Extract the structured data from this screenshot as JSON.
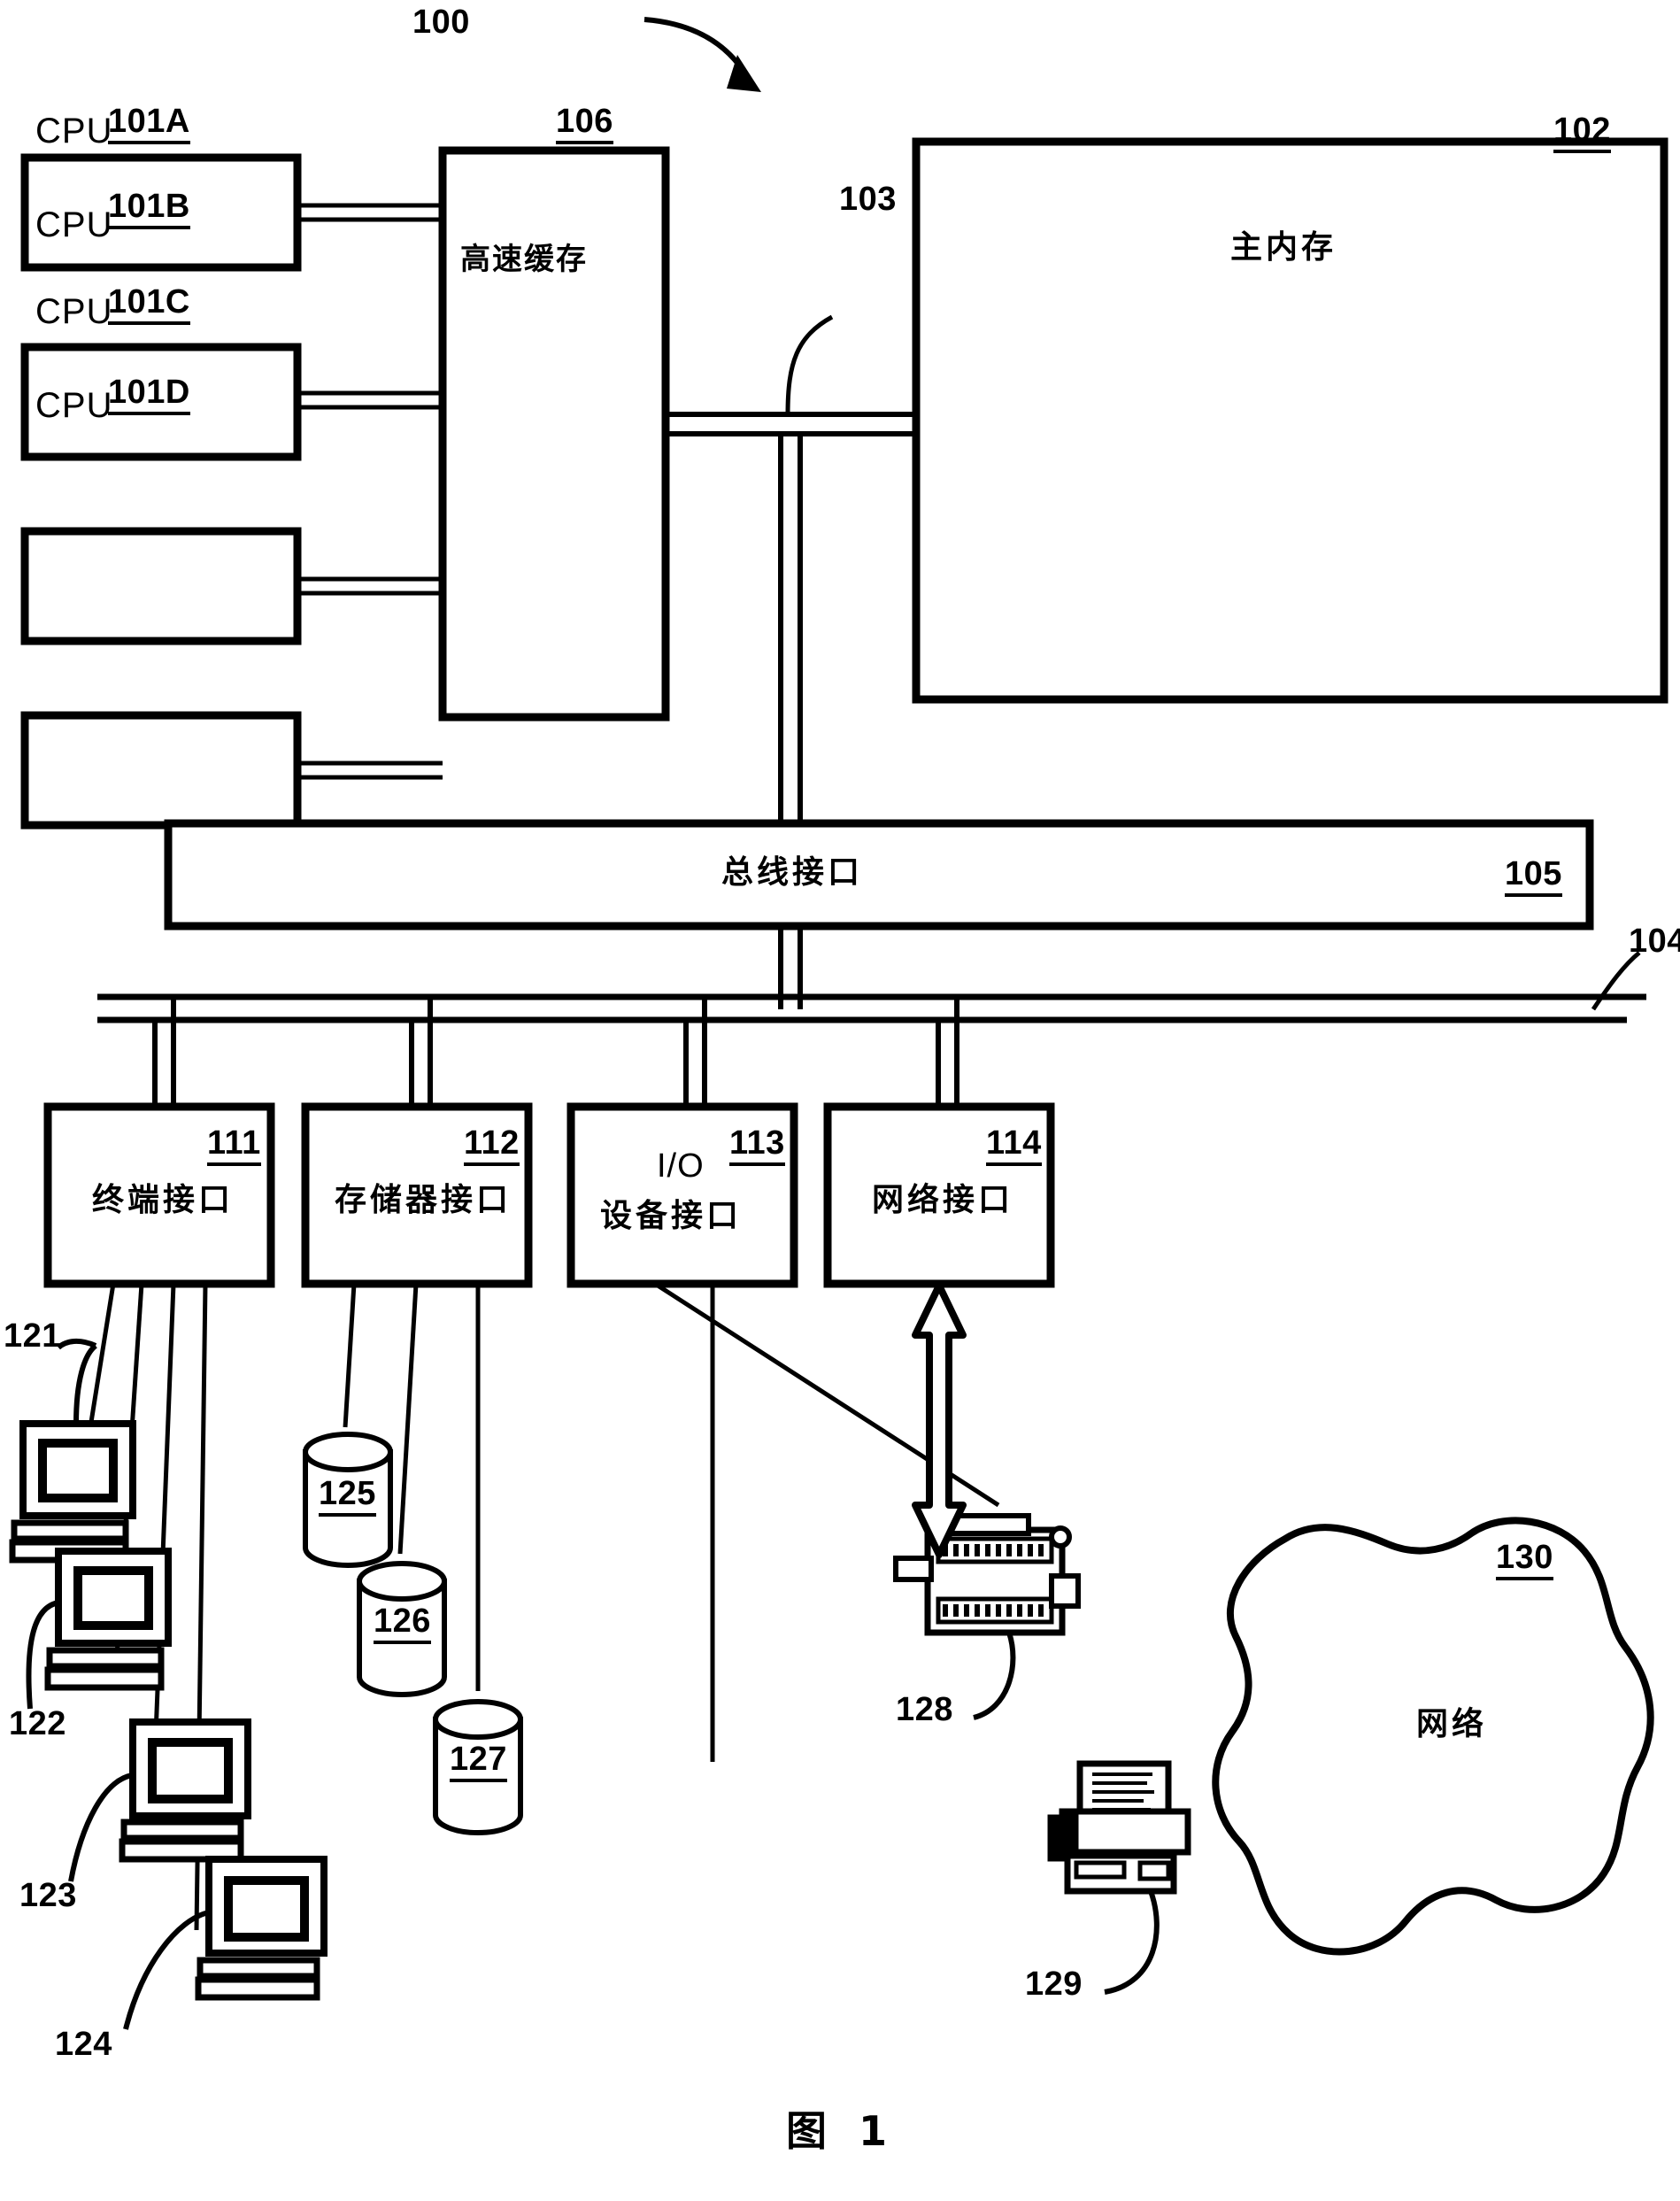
{
  "figure": {
    "caption": "图 1",
    "system_ref": "100"
  },
  "cpus": [
    {
      "label": "CPU",
      "ref": "101A"
    },
    {
      "label": "CPU",
      "ref": "101B"
    },
    {
      "label": "CPU",
      "ref": "101C"
    },
    {
      "label": "CPU",
      "ref": "101D"
    }
  ],
  "cache": {
    "label": "高速缓存",
    "ref": "106"
  },
  "main_memory": {
    "label": "主内存",
    "ref": "102"
  },
  "memory_bus": {
    "ref": "103"
  },
  "bus_interface": {
    "label": "总线接口",
    "ref": "105"
  },
  "system_bus": {
    "ref": "104"
  },
  "interfaces": [
    {
      "label": "终端接口",
      "label2": "",
      "ref": "111"
    },
    {
      "label": "存储器接口",
      "label2": "",
      "ref": "112"
    },
    {
      "label": "I/O",
      "label2": "设备接口",
      "ref": "113"
    },
    {
      "label": "网络接口",
      "label2": "",
      "ref": "114"
    }
  ],
  "terminals": [
    {
      "ref": "121"
    },
    {
      "ref": "122"
    },
    {
      "ref": "123"
    },
    {
      "ref": "124"
    }
  ],
  "storage_devices": [
    {
      "ref": "125"
    },
    {
      "ref": "126"
    },
    {
      "ref": "127"
    }
  ],
  "io_devices": [
    {
      "ref": "128",
      "kind": "fax-device-icon"
    },
    {
      "ref": "129",
      "kind": "printer-icon"
    }
  ],
  "network": {
    "label": "网络",
    "ref": "130"
  },
  "colors": {
    "ink": "#000000",
    "paper": "#ffffff"
  }
}
